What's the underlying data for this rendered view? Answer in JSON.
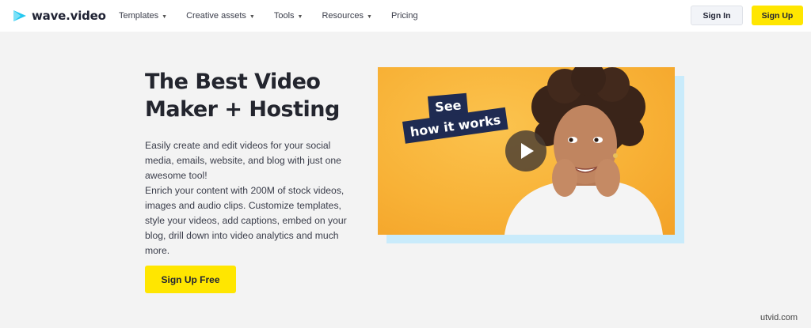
{
  "brand": {
    "name": "wave.video",
    "accent": "#ffe600",
    "navy": "#1f2b52"
  },
  "nav": {
    "items": [
      {
        "label": "Templates",
        "dropdown": true
      },
      {
        "label": "Creative assets",
        "dropdown": true
      },
      {
        "label": "Tools",
        "dropdown": true
      },
      {
        "label": "Resources",
        "dropdown": true
      },
      {
        "label": "Pricing",
        "dropdown": false
      }
    ],
    "chevron": "⌄"
  },
  "header": {
    "signin_label": "Sign In",
    "signup_label": "Sign Up"
  },
  "hero": {
    "title": "The Best Video Maker + Hosting",
    "description_1": "Easily create and edit videos for your social media, emails, website, and blog with just one awesome tool!",
    "description_2": "Enrich your content with 200M of stock videos, images and audio clips. Customize templates, style your videos, add captions, embed on your blog, drill down into video analytics and much more.",
    "cta_label": "Sign Up Free"
  },
  "video": {
    "tag_line_1": "See",
    "tag_line_2": "how it works",
    "play_icon": "play-icon"
  },
  "watermark": "utvid.com"
}
